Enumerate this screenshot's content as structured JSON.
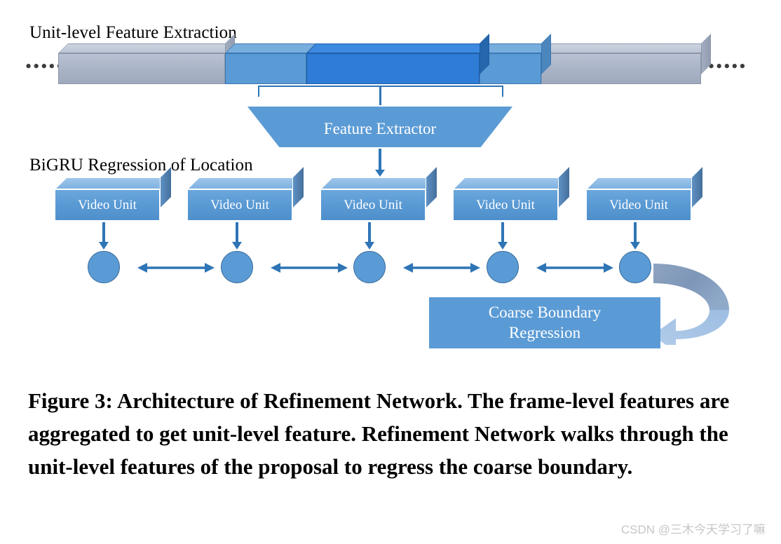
{
  "figure": {
    "sections": {
      "unit_level": "Unit-level Feature Extraction",
      "bigru": "BiGRU Regression of Location"
    },
    "ellipsis_left": "•••••",
    "ellipsis_right": "•••••",
    "feature_extractor_label": "Feature Extractor",
    "video_units": [
      {
        "label": "Video Unit"
      },
      {
        "label": "Video Unit"
      },
      {
        "label": "Video Unit"
      },
      {
        "label": "Video Unit"
      },
      {
        "label": "Video Unit"
      }
    ],
    "coarse_boundary": {
      "line1": "Coarse Boundary",
      "line2": "Regression"
    },
    "timeline_segments": [
      {
        "kind": "gray",
        "note": "context-left"
      },
      {
        "kind": "blue",
        "note": "proposal-start-unit"
      },
      {
        "kind": "darkblue",
        "note": "proposal-center-unit"
      },
      {
        "kind": "blue",
        "note": "proposal-end-unit"
      },
      {
        "kind": "gray",
        "note": "context-right"
      }
    ],
    "icons": {
      "down_arrow": "down-arrow-icon",
      "bidirectional_arrow": "bidirectional-arrow-icon",
      "curved_loop_arrow": "curved-loop-arrow-icon",
      "bracket": "span-bracket-icon"
    },
    "colors": {
      "gray_segment": "#aab4c6",
      "blue_segment": "#5b9bd5",
      "dark_blue_segment": "#2e7cd6",
      "arrow_blue": "#2e75b6",
      "curved_arrow_dark": "#7e96b8",
      "curved_arrow_light": "#a8c6e5",
      "text_on_shape": "#ffffff",
      "caption_text": "#000000",
      "watermark_text": "#c6c6c6"
    }
  },
  "caption": {
    "text": "Figure 3: Architecture of Refinement Network. The frame-level features are aggregated to get unit-level feature. Refinement Network walks through the unit-level features of the proposal to regress the coarse boundary."
  },
  "watermark": {
    "text": "CSDN @三木今天学习了嘛"
  }
}
